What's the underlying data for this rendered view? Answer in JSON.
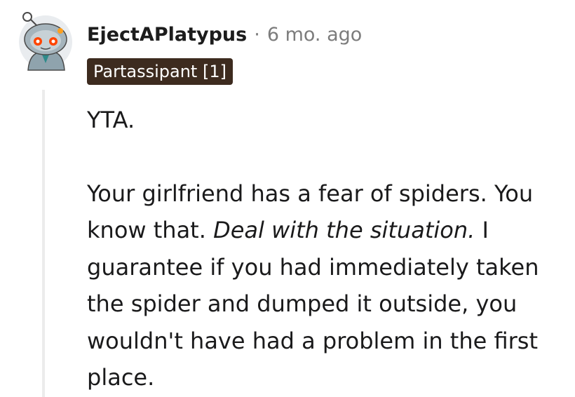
{
  "comment": {
    "username": "EjectAPlatypus",
    "separator": "·",
    "timestamp": "6 mo. ago",
    "flair": "Partassipant [1]",
    "paragraphs": [
      {
        "text": "YTA."
      },
      {
        "before": "Your girlfriend has a fear of spiders. You know that.",
        "emphasis": "Deal with the situation.",
        "after": "I guarantee if you had immediately taken the spider and dumped it outside, you wouldn't have had a problem in the first place."
      }
    ]
  },
  "avatar": {
    "icon": "snoo-avatar-icon"
  },
  "colors": {
    "flair_background": "#3d2b1f",
    "flair_text": "#ffffff",
    "meta_text": "#7c7c7c",
    "thread_line": "#ececec"
  }
}
